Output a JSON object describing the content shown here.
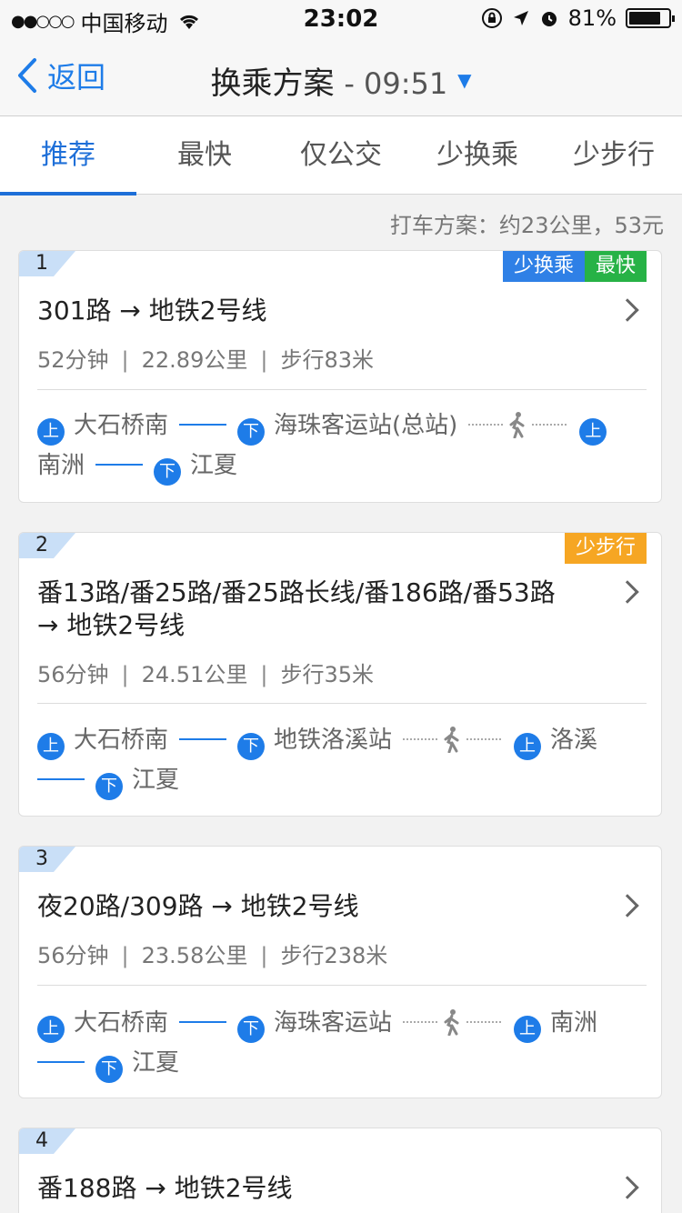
{
  "status": {
    "carrier": "中国移动",
    "time": "23:02",
    "battery": "81%",
    "battery_level": 0.81
  },
  "nav": {
    "back_label": "返回",
    "title": "换乘方案",
    "depart_time": "- 09:51",
    "dropdown_glyph": "▼"
  },
  "tabs": [
    {
      "label": "推荐",
      "active": true
    },
    {
      "label": "最快",
      "active": false
    },
    {
      "label": "仅公交",
      "active": false
    },
    {
      "label": "少换乘",
      "active": false
    },
    {
      "label": "少步行",
      "active": false
    }
  ],
  "taxi": "打车方案：约23公里，53元",
  "routes": [
    {
      "index": "1",
      "badges": [
        {
          "text": "少换乘",
          "color": "#2f80e6"
        },
        {
          "text": "最快",
          "color": "#27b246"
        }
      ],
      "title_line1": "301路 → 地铁2号线",
      "title_line2": "",
      "duration": "52分钟",
      "distance": "22.89公里",
      "walk": "步行83米",
      "board_tag": "上",
      "alight_tag": "下",
      "stop_board_1": "大石桥南",
      "stop_alight_1": "海珠客运站(总站)",
      "stop_board_2": "南洲",
      "stop_alight_2": "江夏"
    },
    {
      "index": "2",
      "badges": [
        {
          "text": "少步行",
          "color": "#f6a623"
        }
      ],
      "title_line1": "番13路/番25路/番25路长线/番186路/番53路",
      "title_line2": "→ 地铁2号线",
      "duration": "56分钟",
      "distance": "24.51公里",
      "walk": "步行35米",
      "board_tag": "上",
      "alight_tag": "下",
      "stop_board_1": "大石桥南",
      "stop_alight_1": "地铁洛溪站",
      "stop_board_2": "洛溪",
      "stop_alight_2": "江夏"
    },
    {
      "index": "3",
      "badges": [],
      "title_line1": "夜20路/309路 → 地铁2号线",
      "title_line2": "",
      "duration": "56分钟",
      "distance": "23.58公里",
      "walk": "步行238米",
      "board_tag": "上",
      "alight_tag": "下",
      "stop_board_1": "大石桥南",
      "stop_alight_1": "海珠客运站",
      "stop_board_2": "南洲",
      "stop_alight_2": "江夏"
    },
    {
      "index": "4",
      "badges": [],
      "title_line1": "番188路 → 地铁2号线",
      "title_line2": ""
    }
  ]
}
